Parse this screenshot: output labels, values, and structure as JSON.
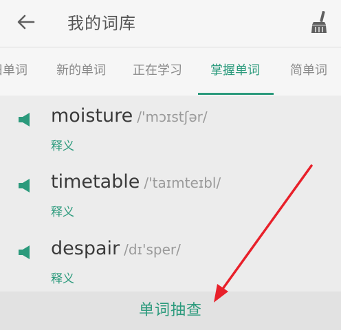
{
  "header": {
    "title": "我的词库",
    "back_icon": "arrow-left-icon",
    "clean_icon": "broom-icon"
  },
  "tabs": [
    {
      "label": "旧单词",
      "active": false
    },
    {
      "label": "新的单词",
      "active": false
    },
    {
      "label": "正在学习",
      "active": false
    },
    {
      "label": "掌握单词",
      "active": true
    },
    {
      "label": "简单词",
      "active": false
    }
  ],
  "words": [
    {
      "word": "moisture",
      "phonetic": "/'mɔɪstʃər/",
      "meaning_label": "释义"
    },
    {
      "word": "timetable",
      "phonetic": "/'taɪmteɪbl/",
      "meaning_label": "释义"
    },
    {
      "word": "despair",
      "phonetic": "/dɪ'sper/",
      "meaning_label": "释义"
    }
  ],
  "bottom": {
    "button_label": "单词抽查"
  },
  "colors": {
    "accent": "#2b9a7c",
    "annotation_arrow": "#e8202a"
  }
}
